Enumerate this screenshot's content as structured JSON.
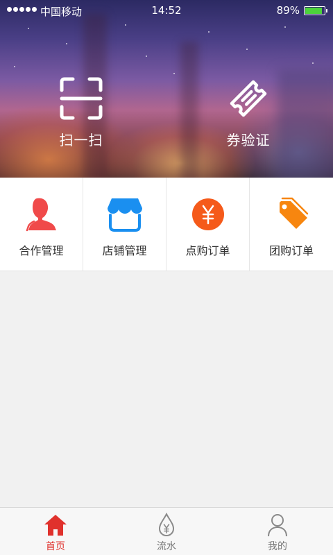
{
  "status_bar": {
    "carrier": "中国移动",
    "time": "14:52",
    "battery_percent": "89%",
    "battery_level": 0.89,
    "signal_bars": 5
  },
  "hero": {
    "actions": [
      {
        "label": "扫一扫",
        "icon": "scan-icon"
      },
      {
        "label": "券验证",
        "icon": "ticket-icon"
      }
    ]
  },
  "grid_menu": {
    "items": [
      {
        "label": "合作管理",
        "icon": "person-icon",
        "color": "#f04a4a"
      },
      {
        "label": "店铺管理",
        "icon": "store-icon",
        "color": "#1a8ff0"
      },
      {
        "label": "点购订单",
        "icon": "yuan-coin-icon",
        "color": "#f55a1a"
      },
      {
        "label": "团购订单",
        "icon": "tag-icon",
        "color": "#f7860f"
      }
    ]
  },
  "tab_bar": {
    "active_index": 0,
    "active_color": "#e0312c",
    "tabs": [
      {
        "label": "首页",
        "icon": "home-icon"
      },
      {
        "label": "流水",
        "icon": "water-drop-yuan-icon"
      },
      {
        "label": "我的",
        "icon": "user-icon"
      }
    ]
  }
}
